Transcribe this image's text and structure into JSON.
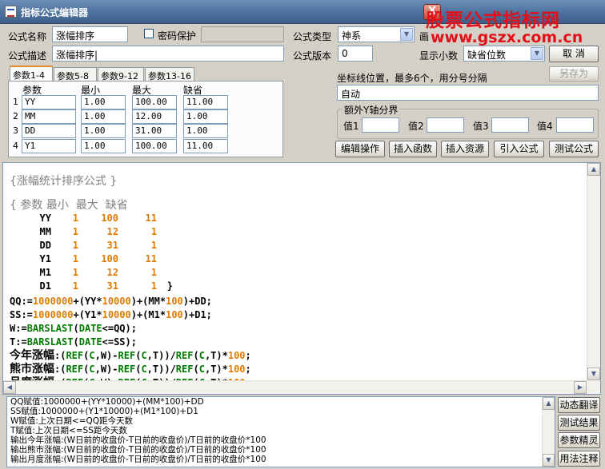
{
  "window": {
    "title": "指标公式编辑器",
    "close_label": "X"
  },
  "watermark": {
    "line1": "股票公式指标网",
    "line2": "www.gszx.com.cn"
  },
  "form": {
    "name_label": "公式名称",
    "name_value": "涨幅排序",
    "password_label": "密码保护",
    "type_label": "公式类型",
    "type_value": "神系",
    "partial_label": "画",
    "desc_label": "公式描述",
    "desc_value": "涨幅排序|",
    "version_label": "公式版本",
    "version_value": "0",
    "decimal_label": "显示小数",
    "decimal_value": "缺省位数"
  },
  "buttons": {
    "cancel": "取 消",
    "save_as": "另存为",
    "edit_ops": "编辑操作",
    "insert_func": "插入函数",
    "insert_res": "插入资源",
    "import_formula": "引入公式",
    "test_formula": "测试公式"
  },
  "tabs": [
    "参数1-4",
    "参数5-8",
    "参数9-12",
    "参数13-16"
  ],
  "param_headers": [
    "参数",
    "最小",
    "最大",
    "缺省"
  ],
  "params": [
    {
      "n": "1",
      "name": "YY",
      "min": "1.00",
      "max": "100.00",
      "def": "11.00"
    },
    {
      "n": "2",
      "name": "MM",
      "min": "1.00",
      "max": "12.00",
      "def": "1.00"
    },
    {
      "n": "3",
      "name": "DD",
      "min": "1.00",
      "max": "31.00",
      "def": "1.00"
    },
    {
      "n": "4",
      "name": "Y1",
      "min": "1.00",
      "max": "100.00",
      "def": "11.00"
    }
  ],
  "axis": {
    "label": "坐标线位置，最多6个，用分号分隔",
    "value": "自动"
  },
  "yaxis": {
    "title": "额外Y轴分界",
    "labels": [
      "值1",
      "值2",
      "值3",
      "值4"
    ]
  },
  "code": {
    "header": "{涨幅统计排序公式 }",
    "param_title": "{ 参数 最小  最大  缺省",
    "rows": [
      {
        "name": "YY",
        "min": "1",
        "max": "100",
        "def": "11"
      },
      {
        "name": "MM",
        "min": "1",
        "max": "12",
        "def": "1"
      },
      {
        "name": "DD",
        "min": "1",
        "max": "31",
        "def": "1"
      },
      {
        "name": "Y1",
        "min": "1",
        "max": "100",
        "def": "11"
      },
      {
        "name": "M1",
        "min": "1",
        "max": "12",
        "def": "1"
      },
      {
        "name": "D1",
        "min": "1",
        "max": "31",
        "def": "1"
      }
    ],
    "close_brace": "}"
  },
  "output": [
    "QQ赋值:1000000+(YY*10000)+(MM*100)+DD",
    "SS赋值:1000000+(Y1*10000)+(M1*100)+D1",
    "W赋值:上次日期<=QQ距今天数",
    "T赋值:上次日期<=SS距今天数",
    "输出今年涨幅:(W日前的收盘价-T日前的收盘价)/T日前的收盘价*100",
    "输出熊市涨幅:(W日前的收盘价-T日前的收盘价)/T日前的收盘价*100",
    "输出月度涨幅:(W日前的收盘价-T日前的收盘价)/T日前的收盘价*100"
  ],
  "side_buttons": [
    "动态翻译",
    "测试结果",
    "参数精灵",
    "用法注释"
  ]
}
